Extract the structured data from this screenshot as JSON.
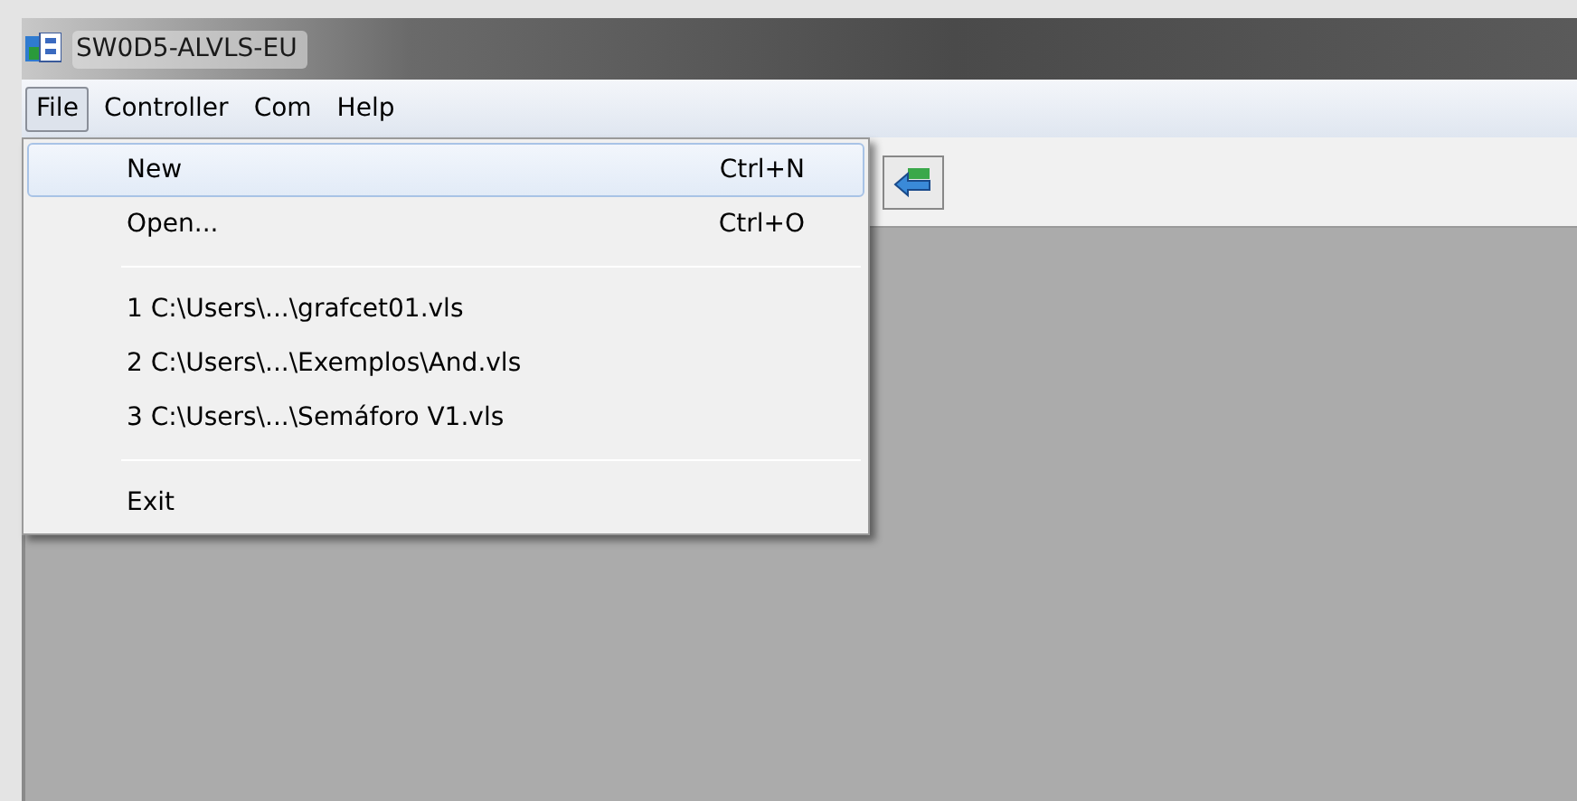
{
  "window": {
    "title": "SW0D5-ALVLS-EU"
  },
  "menu_bar": [
    {
      "label": "File",
      "selected": true
    },
    {
      "label": "Controller",
      "selected": false
    },
    {
      "label": "Com",
      "selected": false
    },
    {
      "label": "Help",
      "selected": false
    }
  ],
  "file_menu": [
    {
      "kind": "item",
      "label": "New",
      "shortcut": "Ctrl+N",
      "selected": true
    },
    {
      "kind": "item",
      "label": "Open...",
      "shortcut": "Ctrl+O",
      "selected": false
    },
    {
      "kind": "separator"
    },
    {
      "kind": "item",
      "label": "1 C:\\Users\\...\\grafcet01.vls",
      "selected": false
    },
    {
      "kind": "item",
      "label": "2 C:\\Users\\...\\Exemplos\\And.vls",
      "selected": false
    },
    {
      "kind": "item",
      "label": "3 C:\\Users\\...\\Semáforo V1.vls",
      "selected": false
    },
    {
      "kind": "separator"
    },
    {
      "kind": "item",
      "label": "Exit",
      "selected": false
    }
  ]
}
